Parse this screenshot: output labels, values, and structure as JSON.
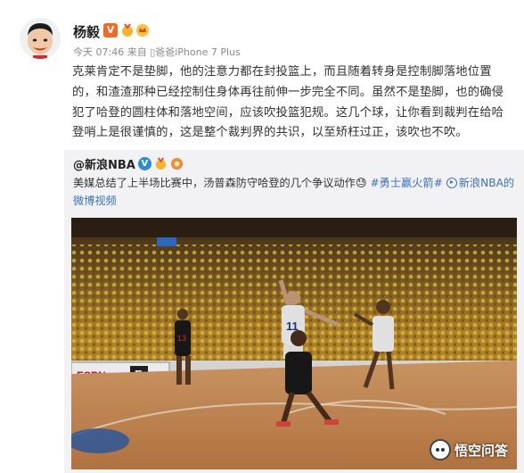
{
  "post": {
    "username": "杨毅",
    "verified_badge": "V",
    "meta": "今天 07:46 来自 ▯爸爸iPhone 7 Plus",
    "content": "克莱肯定不是垫脚，他的注意力都在封投篮上，而且随着转身是控制脚落地位置的，和渣渣那种已经控制住身体再往前伸一步完全不同。虽然不是垫脚，也的确侵犯了哈登的圆柱体和落地空间，应该吹投篮犯规。这几个球，让你看到裁判在给哈登哨上是很谨慎的，这是整个裁判界的共识，以至矫枉过正，该吹也不吹。"
  },
  "repost": {
    "username": "@新浪NBA",
    "verified_badge": "V",
    "text_main": "美媒总结了上半场比赛中，汤普森防守哈登的几个争议动作",
    "emoji": "😓",
    "hashtag": "#勇士赢火箭#",
    "video_link": "新浪NBA的微博视频"
  },
  "video": {
    "player_number_white": "11",
    "player_number_dark": "13",
    "court_ad": "ESPN",
    "scoreboard_ad": "E"
  },
  "watermark": {
    "text": "悟空问答"
  },
  "colors": {
    "accent_orange": "#f26a22",
    "link_blue": "#3a72b8",
    "repost_bg": "#f2f2f5"
  }
}
